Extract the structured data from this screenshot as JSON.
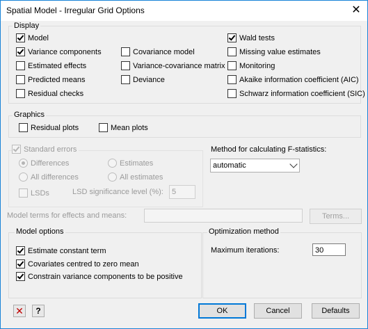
{
  "window": {
    "title": "Spatial Model - Irregular Grid Options",
    "close_glyph": "✕"
  },
  "display": {
    "label": "Display",
    "col1": [
      {
        "label": "Model",
        "checked": true
      },
      {
        "label": "Variance components",
        "checked": true
      },
      {
        "label": "Estimated effects",
        "checked": false
      },
      {
        "label": "Predicted means",
        "checked": false
      },
      {
        "label": "Residual checks",
        "checked": false
      }
    ],
    "col2": [
      {
        "label": "Covariance model",
        "checked": false
      },
      {
        "label": "Variance-covariance matrix",
        "checked": false
      },
      {
        "label": "Deviance",
        "checked": false
      }
    ],
    "col3": [
      {
        "label": "Wald tests",
        "checked": true
      },
      {
        "label": "Missing value estimates",
        "checked": false
      },
      {
        "label": "Monitoring",
        "checked": false
      },
      {
        "label": "Akaike information coefficient (AIC)",
        "checked": false
      },
      {
        "label": "Schwarz information coefficient (SIC)",
        "checked": false
      }
    ]
  },
  "graphics": {
    "label": "Graphics",
    "residual_plots": "Residual plots",
    "mean_plots": "Mean plots"
  },
  "standard_errors": {
    "label": "Standard errors",
    "differences": "Differences",
    "estimates": "Estimates",
    "all_differences": "All differences",
    "all_estimates": "All estimates",
    "lsds": "LSDs",
    "lsd_level_label": "LSD significance level (%):",
    "lsd_level_value": "5"
  },
  "fstat": {
    "label": "Method for calculating F-statistics:",
    "selected": "automatic"
  },
  "model_terms": {
    "label": "Model terms for effects and means:",
    "value": "",
    "terms_button": "Terms..."
  },
  "model_options": {
    "label": "Model options",
    "items": [
      {
        "label": "Estimate constant term",
        "checked": true
      },
      {
        "label": "Covariates centred to zero mean",
        "checked": true
      },
      {
        "label": "Constrain variance components to be positive",
        "checked": true
      }
    ]
  },
  "optimization": {
    "label": "Optimization method",
    "max_iter_label": "Maximum iterations:",
    "max_iter_value": "30"
  },
  "footer": {
    "clear_glyph": "✕",
    "help_glyph": "?",
    "ok": "OK",
    "cancel": "Cancel",
    "defaults": "Defaults"
  },
  "colors": {
    "accent": "#0078d7",
    "clear_red": "#c00000"
  }
}
